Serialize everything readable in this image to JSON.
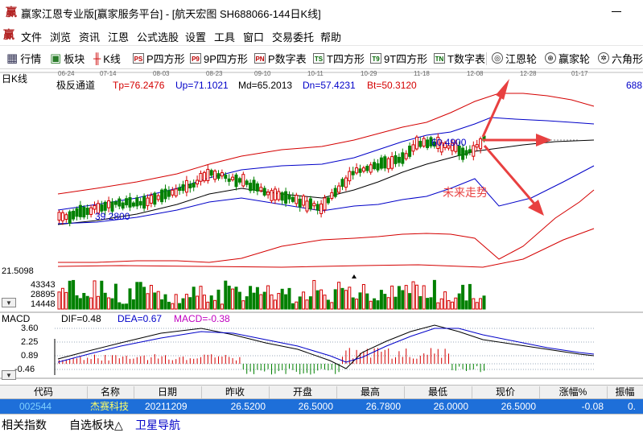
{
  "window": {
    "title": "赢家江恩专业版[赢家服务平台] - [航天宏图  SH688066-144日K线]",
    "logo_glyph": "赢",
    "minimize_icon": "minimize-icon"
  },
  "menu": {
    "logo_glyph": "赢",
    "items": [
      "文件",
      "浏览",
      "资讯",
      "江恩",
      "公式选股",
      "设置",
      "工具",
      "窗口",
      "交易委托",
      "帮助"
    ]
  },
  "toolbar": {
    "items": [
      {
        "label": "行情",
        "icon": "grid-icon",
        "glyph": "▦"
      },
      {
        "label": "板块",
        "icon": "blocks-icon",
        "glyph": "▣"
      },
      {
        "label": "K线",
        "icon": "candle-icon",
        "glyph": "╫"
      },
      {
        "label": "P四方形",
        "icon": "p-square-icon",
        "glyph": "PS"
      },
      {
        "label": "9P四方形",
        "icon": "p9-square-icon",
        "glyph": "P9"
      },
      {
        "label": "P数字表",
        "icon": "p-number-icon",
        "glyph": "PN"
      },
      {
        "label": "T四方形",
        "icon": "t-square-icon",
        "glyph": "TS"
      },
      {
        "label": "9T四方形",
        "icon": "t9-square-icon",
        "glyph": "T9"
      },
      {
        "label": "T数字表",
        "icon": "t-number-icon",
        "glyph": "TN"
      },
      {
        "label": "江恩轮",
        "icon": "gann-wheel-icon",
        "glyph": "◎"
      },
      {
        "label": "赢家轮",
        "icon": "winner-wheel-icon",
        "glyph": "⊕"
      },
      {
        "label": "六角形",
        "icon": "hexagon-icon",
        "glyph": "✲"
      }
    ]
  },
  "kline": {
    "panel_label": "日K线",
    "dates": [
      "06-24",
      "07-14",
      "08-03",
      "08-23",
      "09-10",
      "10-11",
      "10-29",
      "11-18",
      "12-08",
      "12-28",
      "01-17"
    ],
    "indicator_name": "极反通道",
    "indicators": [
      {
        "label": "Tp=76.2476",
        "color": "#d40000"
      },
      {
        "label": "Up=71.1021",
        "color": "#0000c8"
      },
      {
        "label": "Md=65.2013",
        "color": "#000000"
      },
      {
        "label": "Dn=57.4231",
        "color": "#0000c8"
      },
      {
        "label": "Bt=50.3120",
        "color": "#d40000"
      }
    ],
    "right_axis_value": "688",
    "price_mark_high": "60.4900",
    "price_mark_low": "39.2800",
    "annotation": "未来走势"
  },
  "volume": {
    "ticks": [
      "21.5098",
      "43343",
      "28895",
      "14448"
    ]
  },
  "macd": {
    "panel_label": "MACD",
    "dif": "DIF=0.48",
    "dea": "DEA=0.67",
    "macd": "MACD=-0.38",
    "ticks": [
      "3.60",
      "2.25",
      "0.89",
      "-0.46"
    ]
  },
  "table": {
    "headers": [
      "代码",
      "名称",
      "日期",
      "昨收",
      "开盘",
      "最高",
      "最低",
      "现价",
      "涨幅%",
      "振幅"
    ],
    "row": [
      "002544",
      "杰赛科技",
      "20211209",
      "26.5200",
      "26.5000",
      "26.7800",
      "26.0000",
      "26.5000",
      "-0.08",
      "0."
    ]
  },
  "bottom_tabs": [
    "相关指数",
    "自选板块△",
    "卫星导航"
  ],
  "colors": {
    "up": "#d40000",
    "down": "#008000",
    "band_outer": "#d40000",
    "band_inner": "#0000c8",
    "mid": "#000000",
    "arrow": "#e84040",
    "selected_row": "#1e6fd9"
  }
}
